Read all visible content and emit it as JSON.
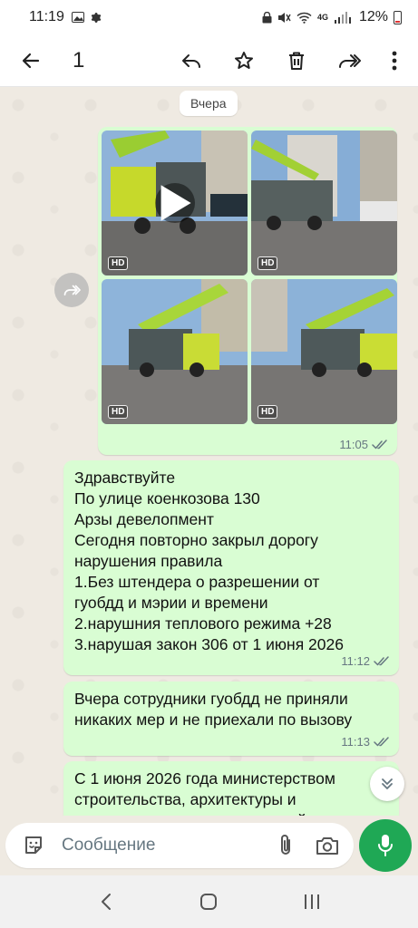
{
  "status_bar": {
    "time": "11:19",
    "battery": "12%",
    "network": "4G"
  },
  "app_bar": {
    "selected_count": "1"
  },
  "chat": {
    "date_separator": "Вчера",
    "media_message": {
      "time": "11:05",
      "thumbnails": [
        {
          "badge": "HD",
          "is_video": true
        },
        {
          "badge": "HD",
          "is_video": false
        },
        {
          "badge": "HD",
          "is_video": false
        },
        {
          "badge": "HD",
          "is_video": false
        }
      ]
    },
    "messages": [
      {
        "lines": [
          "Здравствуйте",
          "По улице коенкозова 130",
          "Арзы девелопмент",
          "Сегодня повторно закрыл дорогу",
          "нарушения правила",
          "1.Без штендера о разрешении от",
          "гуобдд и мэрии и времени",
          "2.нарушния теплового режима +28",
          "3.нарушая  закон 306 от 1 июня 2026"
        ],
        "time": "11:12"
      },
      {
        "lines": [
          "Вчера сотрудники гуобдд не приняли",
          "никаких мер и не приехали по вызову"
        ],
        "time": "11:13"
      },
      {
        "lines": [
          "С 1 июня 2026 года министерством",
          "строительства, архитектуры и",
          "жилищно-коммунального хозяйства"
        ],
        "time": ""
      }
    ]
  },
  "composer": {
    "placeholder": "Сообщение"
  },
  "colors": {
    "outgoing_bubble": "#d9fdd3",
    "chat_background": "#efeae2",
    "mic_button": "#1fa855",
    "read_ticks": "#667781"
  }
}
